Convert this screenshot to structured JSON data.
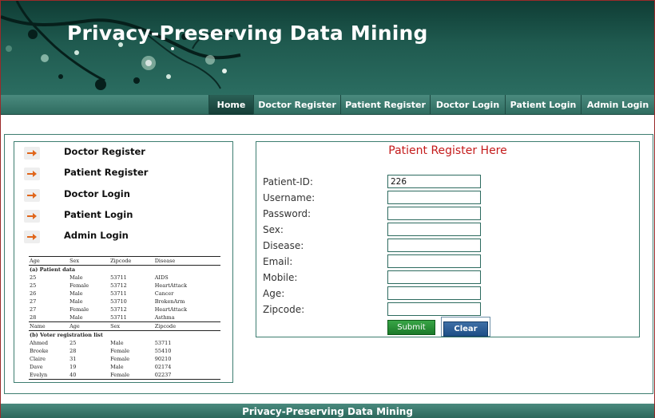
{
  "header": {
    "title": "Privacy-Preserving Data Mining"
  },
  "nav": {
    "items": [
      {
        "label": "Home",
        "active": true
      },
      {
        "label": "Doctor Register"
      },
      {
        "label": "Patient Register"
      },
      {
        "label": "Doctor Login"
      },
      {
        "label": "Patient Login"
      },
      {
        "label": "Admin Login"
      }
    ]
  },
  "sidebar": {
    "items": [
      {
        "label": "Doctor Register",
        "icon": "arrow-right-icon"
      },
      {
        "label": "Patient Register",
        "icon": "arrow-right-icon"
      },
      {
        "label": "Doctor Login",
        "icon": "arrow-right-icon"
      },
      {
        "label": "Patient Login",
        "icon": "arrow-right-icon"
      },
      {
        "label": "Admin Login",
        "icon": "arrow-right-icon"
      }
    ],
    "table": {
      "patient_header": [
        "Age",
        "Sex",
        "Zipcode",
        "Disease"
      ],
      "patient_caption": "(a) Patient data",
      "patient_rows": [
        [
          "25",
          "Male",
          "53711",
          "AIDS"
        ],
        [
          "25",
          "Female",
          "53712",
          "HeartAttack"
        ],
        [
          "26",
          "Male",
          "53711",
          "Cancer"
        ],
        [
          "27",
          "Male",
          "53710",
          "BrokenArm"
        ],
        [
          "27",
          "Female",
          "53712",
          "HeartAttack"
        ],
        [
          "28",
          "Male",
          "53711",
          "Asthma"
        ]
      ],
      "voter_header": [
        "Name",
        "Age",
        "Sex",
        "Zipcode"
      ],
      "voter_caption": "(b) Voter registration list",
      "voter_rows": [
        [
          "Ahmed",
          "25",
          "Male",
          "53711"
        ],
        [
          "Brooke",
          "28",
          "Female",
          "55410"
        ],
        [
          "Claire",
          "31",
          "Female",
          "90210"
        ],
        [
          "Dave",
          "19",
          "Male",
          "02174"
        ],
        [
          "Evelyn",
          "40",
          "Female",
          "02237"
        ]
      ]
    }
  },
  "form": {
    "title": "Patient Register Here",
    "fields": [
      {
        "label": "Patient-ID:",
        "value": "226"
      },
      {
        "label": "Username:",
        "value": ""
      },
      {
        "label": "Password:",
        "value": ""
      },
      {
        "label": "Sex:",
        "value": ""
      },
      {
        "label": "Disease:",
        "value": ""
      },
      {
        "label": "Email:",
        "value": ""
      },
      {
        "label": "Mobile:",
        "value": ""
      },
      {
        "label": "Age:",
        "value": ""
      },
      {
        "label": "Zipcode:",
        "value": ""
      }
    ],
    "submit_label": "Submit",
    "clear_label": "Clear"
  },
  "footer": {
    "text": "Privacy-Preserving Data Mining"
  },
  "colors": {
    "header_dark": "#0f3d35",
    "nav_green": "#2f6c60",
    "form_title_red": "#c41b1b",
    "submit_green": "#1b7a29",
    "clear_blue": "#1d4e86"
  }
}
